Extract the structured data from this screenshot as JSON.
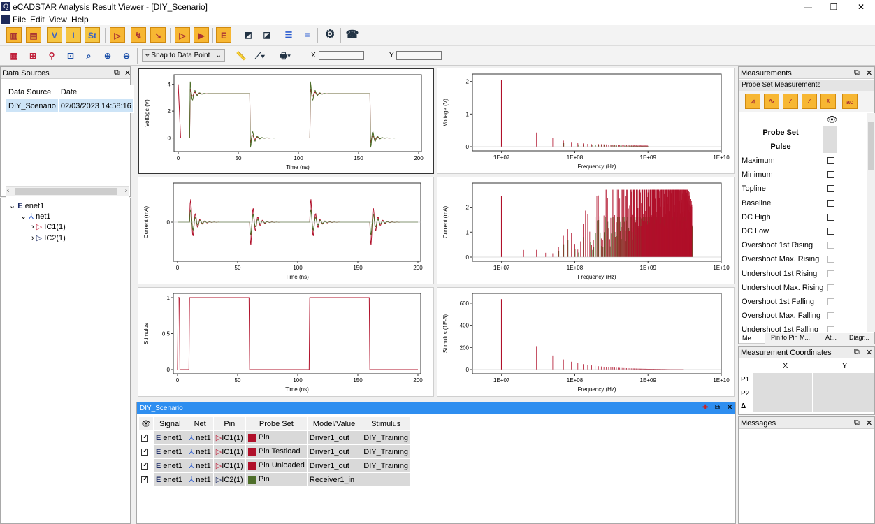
{
  "window": {
    "title": "eCADSTAR Analysis Result Viewer - [DIY_Scenario]",
    "minimize": "—",
    "restore": "❐",
    "close": "✕"
  },
  "menu": [
    "File",
    "Edit",
    "View",
    "Help"
  ],
  "toolbar2": {
    "snap_label": "Snap to Data Point",
    "x_label": "X",
    "y_label": "Y",
    "x_value": "",
    "y_value": ""
  },
  "data_sources": {
    "title": "Data Sources",
    "col1": "Data Source",
    "col2": "Date",
    "rows": [
      {
        "name": "DIY_Scenario",
        "date": "02/03/2023 14:58:16"
      }
    ]
  },
  "tree": {
    "root": "enet1",
    "net": "net1",
    "pins": [
      "IC1(1)",
      "IC2(1)"
    ]
  },
  "plots": {
    "time_axis": {
      "ticks": [
        "0",
        "50",
        "100",
        "150",
        "200"
      ],
      "label": "Time (ns)"
    },
    "freq_axis": {
      "ticks": [
        "1E+07",
        "1E+08",
        "1E+09",
        "1E+10"
      ],
      "label": "Frequency (Hz)"
    },
    "voltage": {
      "ylabel": "Voltage (V)",
      "yticks": [
        "4",
        "2",
        "0"
      ]
    },
    "voltage_f": {
      "ylabel": "Voltage (V)",
      "yticks": [
        "2",
        "1",
        "0"
      ]
    },
    "current": {
      "ylabel": "Current (mA)",
      "yticks": [
        "0"
      ]
    },
    "current_f": {
      "ylabel": "Current (mA)",
      "yticks": [
        "2",
        "1",
        "0"
      ]
    },
    "stimulus": {
      "ylabel": "Stimulus",
      "yticks": [
        "1",
        "0.5",
        "0"
      ]
    },
    "stimulus_f": {
      "ylabel": "Stimulus (1E-3)",
      "yticks": [
        "600",
        "400",
        "200",
        "0"
      ]
    }
  },
  "measurements": {
    "title": "Measurements",
    "sub": "Probe Set Measurements",
    "probe_set": "Probe Set",
    "pulse": "Pulse",
    "items": [
      "Maximum",
      "Minimum",
      "Topline",
      "Baseline",
      "DC High",
      "DC Low",
      "Overshoot 1st Rising",
      "Overshoot Max. Rising",
      "Undershoot 1st Rising",
      "Undershoot Max. Rising",
      "Overshoot 1st Falling",
      "Overshoot Max. Falling",
      "Undershoot 1st Falling"
    ],
    "tabs": [
      "Me...",
      "Pin to Pin M...",
      "At...",
      "Diagr..."
    ]
  },
  "coords": {
    "title": "Measurement Coordinates",
    "x": "X",
    "y": "Y",
    "rows": [
      "P1",
      "P2",
      "Δ"
    ]
  },
  "messages": {
    "title": "Messages"
  },
  "scenario": {
    "title": "DIY_Scenario",
    "headers": [
      "Signal",
      "Net",
      "Pin",
      "Probe Set",
      "Model/Value",
      "Stimulus"
    ],
    "rows": [
      {
        "signal": "enet1",
        "net": "net1",
        "pin": "IC1(1)",
        "probe": "Pin",
        "model": "Driver1_out",
        "stim": "DIY_Training",
        "color": "#b0102a"
      },
      {
        "signal": "enet1",
        "net": "net1",
        "pin": "IC1(1)",
        "probe": "Pin Testload",
        "model": "Driver1_out",
        "stim": "DIY_Training",
        "color": "#b0102a"
      },
      {
        "signal": "enet1",
        "net": "net1",
        "pin": "IC1(1)",
        "probe": "Pin Unloaded",
        "model": "Driver1_out",
        "stim": "DIY_Training",
        "color": "#b0102a"
      },
      {
        "signal": "enet1",
        "net": "net1",
        "pin": "IC2(1)",
        "probe": "Pin",
        "model": "Receiver1_in",
        "stim": "",
        "color": "#4e6e2a"
      }
    ]
  }
}
